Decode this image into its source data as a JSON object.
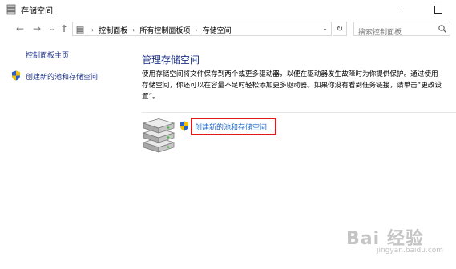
{
  "window": {
    "title": "存储空间",
    "minimize_glyph": "—",
    "maximize_glyph": "☐"
  },
  "nav": {
    "back_icon": "←",
    "forward_icon": "→",
    "recent_icon": "⌄",
    "up_icon": "↑"
  },
  "address": {
    "breadcrumbs": [
      "控制面板",
      "所有控制面板项",
      "存储空间"
    ],
    "separator": "›",
    "refresh_icon": "↻"
  },
  "search": {
    "placeholder": "搜索控制面板"
  },
  "sidebar": {
    "home_label": "控制面板主页",
    "create_label": "创建新的池和存储空间"
  },
  "main": {
    "title": "管理存储空间",
    "description": "使用存储空间将文件保存到两个或更多驱动器，以便在驱动器发生故障时为你提供保护。通过使用存储空间，你还可以在容量不足时轻松添加更多驱动器。如果你没有看到任务链接，请单击“更改设置”。",
    "create_link": "创建新的池和存储空间"
  },
  "watermark": {
    "main": "Bai 经验",
    "sub": "jingyan.baidu.com"
  },
  "colors": {
    "link": "#1e3287",
    "link_highlight": "#1e6bc8",
    "highlight_box": "#e01818"
  }
}
